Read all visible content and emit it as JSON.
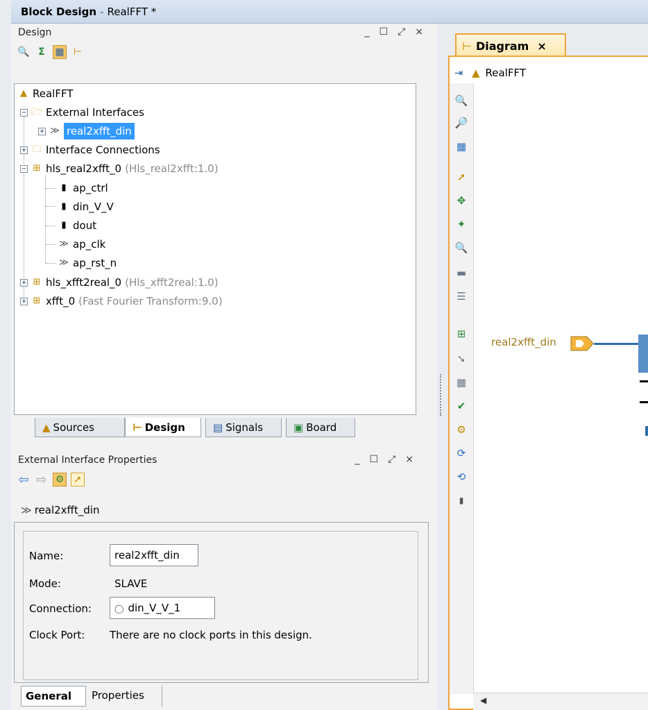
{
  "window": {
    "title_bold": "Block Design",
    "separator": "-",
    "title_rest": "RealFFT *"
  },
  "design_panel": {
    "title": "Design",
    "win_ctrls": [
      "_",
      "☐",
      "⤢",
      "×"
    ],
    "tree": {
      "root": "RealFFT",
      "external_interfaces": "External Interfaces",
      "selected_item": "real2xfft_din",
      "interface_connections": "Interface Connections",
      "ip1_name": "hls_real2xfft_0",
      "ip1_type": "(Hls_real2xfft:1.0)",
      "ip1_children": [
        "ap_ctrl",
        "din_V_V",
        "dout",
        "ap_clk",
        "ap_rst_n"
      ],
      "ip2_name": "hls_xfft2real_0",
      "ip2_type": "(Hls_xfft2real:1.0)",
      "ip3_name": "xfft_0",
      "ip3_type": "(Fast Fourier Transform:9.0)"
    },
    "tabs": [
      "Sources",
      "Design",
      "Signals",
      "Board"
    ],
    "active_tab": "Design"
  },
  "properties_panel": {
    "title": "External Interface Properties",
    "object_name": "real2xfft_din",
    "fields": {
      "name_label": "Name:",
      "name_value": "real2xfft_din",
      "mode_label": "Mode:",
      "mode_value": "SLAVE",
      "connection_label": "Connection:",
      "connection_value": "din_V_V_1",
      "clock_label": "Clock Port:",
      "clock_value": "There are no clock ports in this design."
    },
    "tabs": [
      "General",
      "Properties"
    ],
    "active_tab": "General"
  },
  "diagram": {
    "tab_label": "Diagram",
    "close": "×",
    "breadcrumb": "RealFFT",
    "port_label": "real2xfft_din"
  },
  "colors": {
    "accent_orange": "#f0a23a",
    "selection_blue": "#3399ff",
    "wire_blue": "#2f6fa8",
    "port_gold": "#a07a1c"
  }
}
